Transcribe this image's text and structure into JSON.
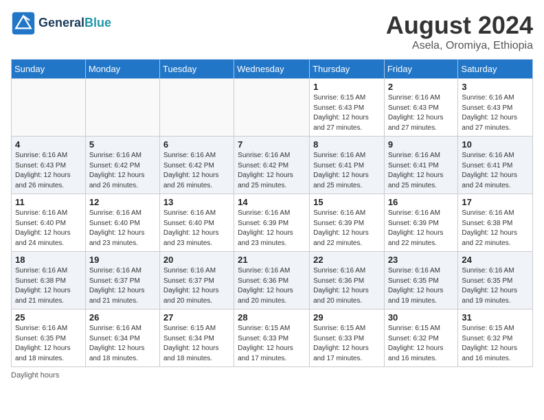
{
  "header": {
    "logo_line1": "General",
    "logo_line2": "Blue",
    "month_year": "August 2024",
    "location": "Asela, Oromiya, Ethiopia"
  },
  "days_of_week": [
    "Sunday",
    "Monday",
    "Tuesday",
    "Wednesday",
    "Thursday",
    "Friday",
    "Saturday"
  ],
  "weeks": [
    [
      {
        "day": "",
        "info": ""
      },
      {
        "day": "",
        "info": ""
      },
      {
        "day": "",
        "info": ""
      },
      {
        "day": "",
        "info": ""
      },
      {
        "day": "1",
        "info": "Sunrise: 6:15 AM\nSunset: 6:43 PM\nDaylight: 12 hours\nand 27 minutes."
      },
      {
        "day": "2",
        "info": "Sunrise: 6:16 AM\nSunset: 6:43 PM\nDaylight: 12 hours\nand 27 minutes."
      },
      {
        "day": "3",
        "info": "Sunrise: 6:16 AM\nSunset: 6:43 PM\nDaylight: 12 hours\nand 27 minutes."
      }
    ],
    [
      {
        "day": "4",
        "info": "Sunrise: 6:16 AM\nSunset: 6:43 PM\nDaylight: 12 hours\nand 26 minutes."
      },
      {
        "day": "5",
        "info": "Sunrise: 6:16 AM\nSunset: 6:42 PM\nDaylight: 12 hours\nand 26 minutes."
      },
      {
        "day": "6",
        "info": "Sunrise: 6:16 AM\nSunset: 6:42 PM\nDaylight: 12 hours\nand 26 minutes."
      },
      {
        "day": "7",
        "info": "Sunrise: 6:16 AM\nSunset: 6:42 PM\nDaylight: 12 hours\nand 25 minutes."
      },
      {
        "day": "8",
        "info": "Sunrise: 6:16 AM\nSunset: 6:41 PM\nDaylight: 12 hours\nand 25 minutes."
      },
      {
        "day": "9",
        "info": "Sunrise: 6:16 AM\nSunset: 6:41 PM\nDaylight: 12 hours\nand 25 minutes."
      },
      {
        "day": "10",
        "info": "Sunrise: 6:16 AM\nSunset: 6:41 PM\nDaylight: 12 hours\nand 24 minutes."
      }
    ],
    [
      {
        "day": "11",
        "info": "Sunrise: 6:16 AM\nSunset: 6:40 PM\nDaylight: 12 hours\nand 24 minutes."
      },
      {
        "day": "12",
        "info": "Sunrise: 6:16 AM\nSunset: 6:40 PM\nDaylight: 12 hours\nand 23 minutes."
      },
      {
        "day": "13",
        "info": "Sunrise: 6:16 AM\nSunset: 6:40 PM\nDaylight: 12 hours\nand 23 minutes."
      },
      {
        "day": "14",
        "info": "Sunrise: 6:16 AM\nSunset: 6:39 PM\nDaylight: 12 hours\nand 23 minutes."
      },
      {
        "day": "15",
        "info": "Sunrise: 6:16 AM\nSunset: 6:39 PM\nDaylight: 12 hours\nand 22 minutes."
      },
      {
        "day": "16",
        "info": "Sunrise: 6:16 AM\nSunset: 6:39 PM\nDaylight: 12 hours\nand 22 minutes."
      },
      {
        "day": "17",
        "info": "Sunrise: 6:16 AM\nSunset: 6:38 PM\nDaylight: 12 hours\nand 22 minutes."
      }
    ],
    [
      {
        "day": "18",
        "info": "Sunrise: 6:16 AM\nSunset: 6:38 PM\nDaylight: 12 hours\nand 21 minutes."
      },
      {
        "day": "19",
        "info": "Sunrise: 6:16 AM\nSunset: 6:37 PM\nDaylight: 12 hours\nand 21 minutes."
      },
      {
        "day": "20",
        "info": "Sunrise: 6:16 AM\nSunset: 6:37 PM\nDaylight: 12 hours\nand 20 minutes."
      },
      {
        "day": "21",
        "info": "Sunrise: 6:16 AM\nSunset: 6:36 PM\nDaylight: 12 hours\nand 20 minutes."
      },
      {
        "day": "22",
        "info": "Sunrise: 6:16 AM\nSunset: 6:36 PM\nDaylight: 12 hours\nand 20 minutes."
      },
      {
        "day": "23",
        "info": "Sunrise: 6:16 AM\nSunset: 6:35 PM\nDaylight: 12 hours\nand 19 minutes."
      },
      {
        "day": "24",
        "info": "Sunrise: 6:16 AM\nSunset: 6:35 PM\nDaylight: 12 hours\nand 19 minutes."
      }
    ],
    [
      {
        "day": "25",
        "info": "Sunrise: 6:16 AM\nSunset: 6:35 PM\nDaylight: 12 hours\nand 18 minutes."
      },
      {
        "day": "26",
        "info": "Sunrise: 6:16 AM\nSunset: 6:34 PM\nDaylight: 12 hours\nand 18 minutes."
      },
      {
        "day": "27",
        "info": "Sunrise: 6:15 AM\nSunset: 6:34 PM\nDaylight: 12 hours\nand 18 minutes."
      },
      {
        "day": "28",
        "info": "Sunrise: 6:15 AM\nSunset: 6:33 PM\nDaylight: 12 hours\nand 17 minutes."
      },
      {
        "day": "29",
        "info": "Sunrise: 6:15 AM\nSunset: 6:33 PM\nDaylight: 12 hours\nand 17 minutes."
      },
      {
        "day": "30",
        "info": "Sunrise: 6:15 AM\nSunset: 6:32 PM\nDaylight: 12 hours\nand 16 minutes."
      },
      {
        "day": "31",
        "info": "Sunrise: 6:15 AM\nSunset: 6:32 PM\nDaylight: 12 hours\nand 16 minutes."
      }
    ]
  ],
  "footer": "Daylight hours"
}
